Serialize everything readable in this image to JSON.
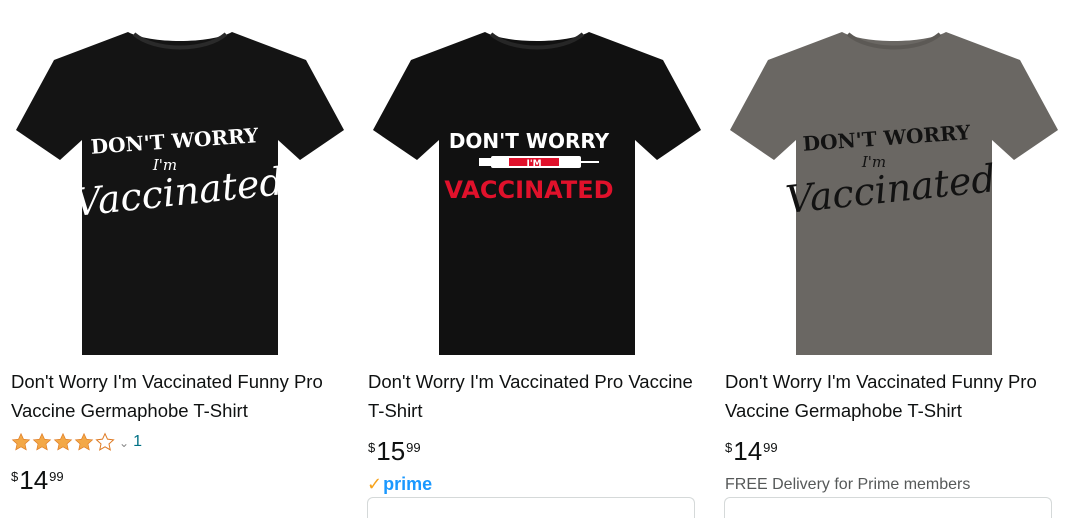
{
  "products": [
    {
      "title": "Don't Worry I'm Vaccinated Funny Pro Vaccine Germaphobe T-Shirt",
      "shirt_color": "#141414",
      "print": {
        "line1": "DON'T WORRY",
        "line2": "I'm",
        "line3": "Vaccinated",
        "color": "#ffffff"
      },
      "rating": {
        "stars": 4,
        "out_of": 5,
        "count": "1"
      },
      "price": {
        "symbol": "$",
        "whole": "14",
        "fraction": "99"
      }
    },
    {
      "title": "Don't Worry I'm Vaccinated Pro Vaccine T-Shirt",
      "shirt_color": "#111111",
      "print": {
        "line1": "DON'T WORRY",
        "line2": "I'M",
        "line3": "VACCINATED",
        "color": "#ffffff",
        "accent": "#e0112b"
      },
      "price": {
        "symbol": "$",
        "whole": "15",
        "fraction": "99"
      },
      "prime": {
        "check": "✓",
        "label": "prime"
      }
    },
    {
      "title": "Don't Worry I'm Vaccinated Funny Pro Vaccine Germaphobe T-Shirt",
      "shirt_color": "#6a6763",
      "print": {
        "line1": "DON'T WORRY",
        "line2": "I'm",
        "line3": "Vaccinated",
        "color": "#121212"
      },
      "price": {
        "symbol": "$",
        "whole": "14",
        "fraction": "99"
      },
      "delivery": "FREE Delivery for Prime members"
    }
  ],
  "icons": {
    "star": "star-icon",
    "chevron": "chevron-down-icon",
    "check": "prime-check-icon"
  },
  "colors": {
    "link": "#007185",
    "star": "#f3a847",
    "prime": "#1a98ff",
    "prime_check": "#f7a31c",
    "muted": "#565959"
  }
}
